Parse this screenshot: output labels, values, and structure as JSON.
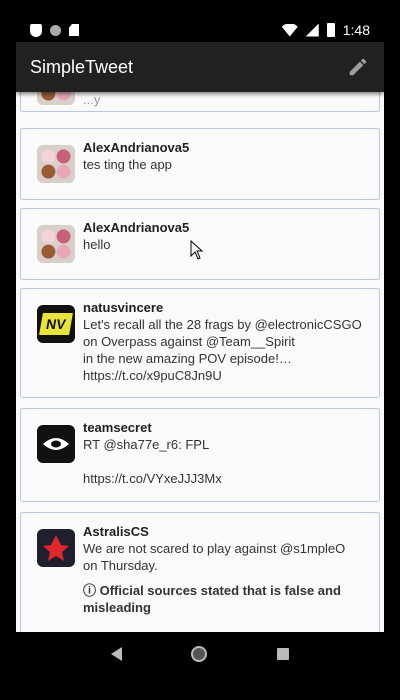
{
  "status_bar": {
    "time": "1:48"
  },
  "app_bar": {
    "title": "SimpleTweet",
    "compose_icon": "pencil-icon"
  },
  "tweets": [
    {
      "username": "",
      "text": "...y",
      "avatar": "donut-box-avatar"
    },
    {
      "username": "AlexAndrianova5",
      "text": "tes ting the app",
      "avatar": "donut-box-avatar"
    },
    {
      "username": "AlexAndrianova5",
      "text": "hello",
      "avatar": "donut-box-avatar"
    },
    {
      "username": "natusvincere",
      "text": "Let's recall all the 28 frags by @electronicCSGO\non Overpass against @Team__Spirit\nin the new amazing POV episode!…\nhttps://t.co/x9puC8Jn9U",
      "avatar": "navi-logo-avatar"
    },
    {
      "username": "teamsecret",
      "text": "RT @sha77e_r6: FPL\n\nhttps://t.co/VYxeJJJ3Mx",
      "avatar": "secret-logo-avatar"
    },
    {
      "username": "AstralisCS",
      "text": "We are not scared to play against @s1mpleO\non Thursday.",
      "notice": "ⓘ  Official sources stated that is false and misleading",
      "avatar": "astralis-logo-avatar"
    }
  ],
  "colors": {
    "app_bar": "#212121",
    "card_border": "#b9c6e6",
    "background": "#fafafa"
  }
}
